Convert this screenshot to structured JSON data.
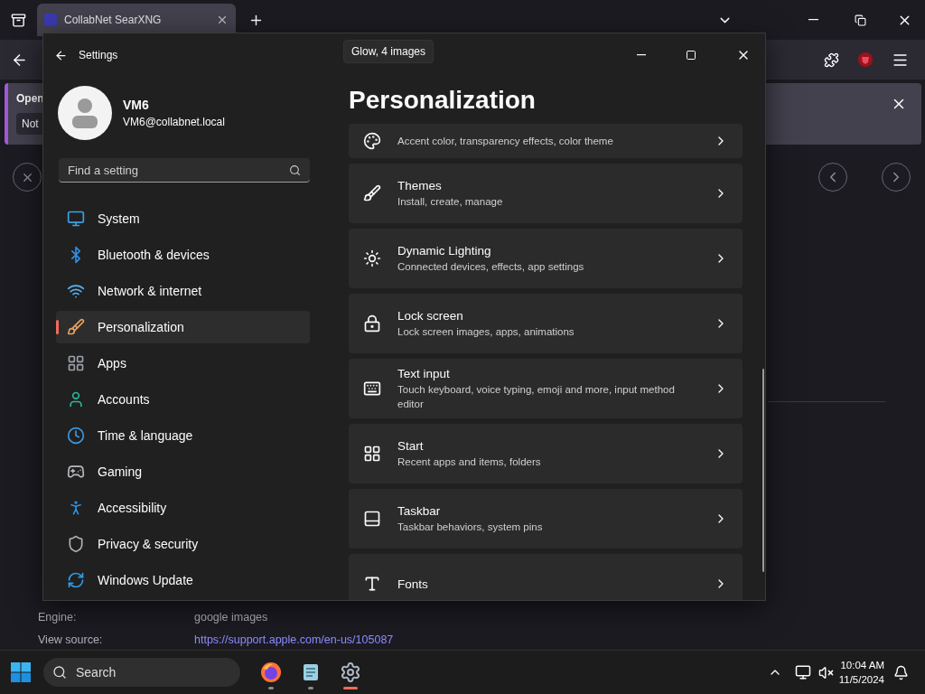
{
  "browser": {
    "tabs": [
      {
        "title": "CollabNet SearXNG",
        "selected": true
      }
    ],
    "notification": {
      "text": "Open",
      "button": "Not"
    },
    "details": [
      {
        "label": "Engine:",
        "value": "google images",
        "kind": "text"
      },
      {
        "label": "View source:",
        "value": "https://support.apple.com/en-us/105087",
        "kind": "link"
      }
    ]
  },
  "tooltip": "Glow, 4 images",
  "settings": {
    "title": "Settings",
    "user": {
      "name": "VM6",
      "email": "VM6@collabnet.local"
    },
    "search": {
      "placeholder": "Find a setting"
    },
    "nav": [
      {
        "label": "System",
        "selected": false
      },
      {
        "label": "Bluetooth & devices",
        "selected": false
      },
      {
        "label": "Network & internet",
        "selected": false
      },
      {
        "label": "Personalization",
        "selected": true
      },
      {
        "label": "Apps",
        "selected": false
      },
      {
        "label": "Accounts",
        "selected": false
      },
      {
        "label": "Time & language",
        "selected": false
      },
      {
        "label": "Gaming",
        "selected": false
      },
      {
        "label": "Accessibility",
        "selected": false
      },
      {
        "label": "Privacy & security",
        "selected": false
      },
      {
        "label": "Windows Update",
        "selected": false
      }
    ],
    "heading": "Personalization",
    "cards": [
      {
        "description": "Accent color, transparency effects, color theme"
      },
      {
        "title": "Themes",
        "description": "Install, create, manage"
      },
      {
        "title": "Dynamic Lighting",
        "description": "Connected devices, effects, app settings"
      },
      {
        "title": "Lock screen",
        "description": "Lock screen images, apps, animations"
      },
      {
        "title": "Text input",
        "description": "Touch keyboard, voice typing, emoji and more, input method editor"
      },
      {
        "title": "Start",
        "description": "Recent apps and items, folders"
      },
      {
        "title": "Taskbar",
        "description": "Taskbar behaviors, system pins"
      },
      {
        "title": "Fonts"
      }
    ]
  },
  "taskbar": {
    "search": {
      "placeholder": "Search"
    },
    "apps": [
      {
        "selected": false
      },
      {
        "selected": false
      },
      {
        "selected": true
      }
    ],
    "time": "10:04 AM",
    "date": "11/5/2024"
  }
}
